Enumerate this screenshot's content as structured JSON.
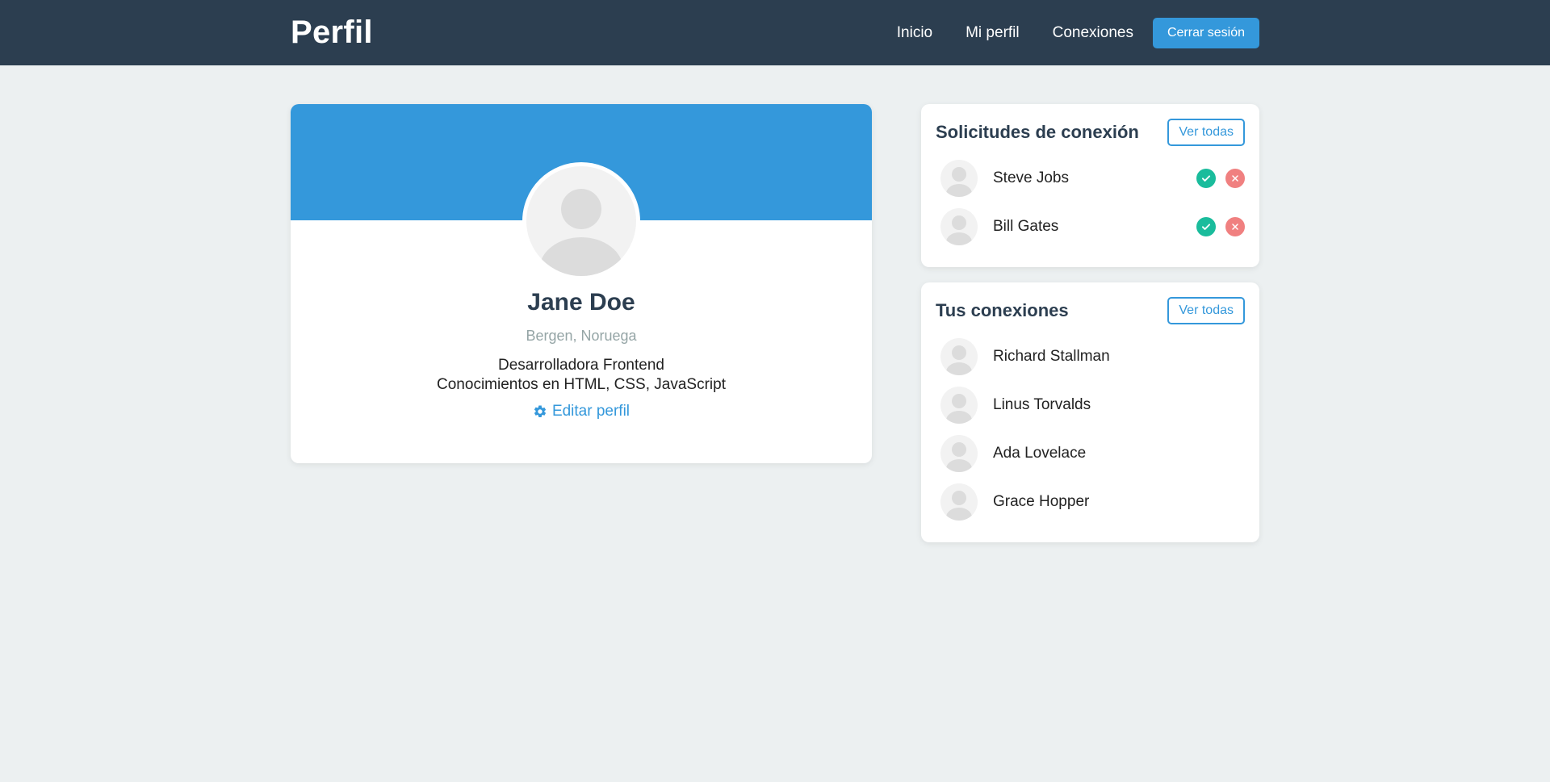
{
  "navbar": {
    "brand": "Perfil",
    "links": [
      "Inicio",
      "Mi perfil",
      "Conexiones"
    ],
    "logout_label": "Cerrar sesión"
  },
  "profile": {
    "name": "Jane Doe",
    "location": "Bergen, Noruega",
    "bio_line1": "Desarrolladora Frontend",
    "bio_line2": "Conocimientos en HTML, CSS, JavaScript",
    "edit_label": "Editar perfil"
  },
  "requests": {
    "title": "Solicitudes de conexión",
    "see_all_label": "Ver todas",
    "items": [
      {
        "name": "Steve Jobs"
      },
      {
        "name": "Bill Gates"
      }
    ]
  },
  "connections": {
    "title": "Tus conexiones",
    "see_all_label": "Ver todas",
    "items": [
      {
        "name": "Richard Stallman"
      },
      {
        "name": "Linus Torvalds"
      },
      {
        "name": "Ada Lovelace"
      },
      {
        "name": "Grace Hopper"
      }
    ]
  },
  "colors": {
    "navbar": "#2c3e50",
    "accent": "#3498db",
    "accept": "#1abc9c",
    "reject": "#f08080",
    "background": "#ecf0f1"
  }
}
